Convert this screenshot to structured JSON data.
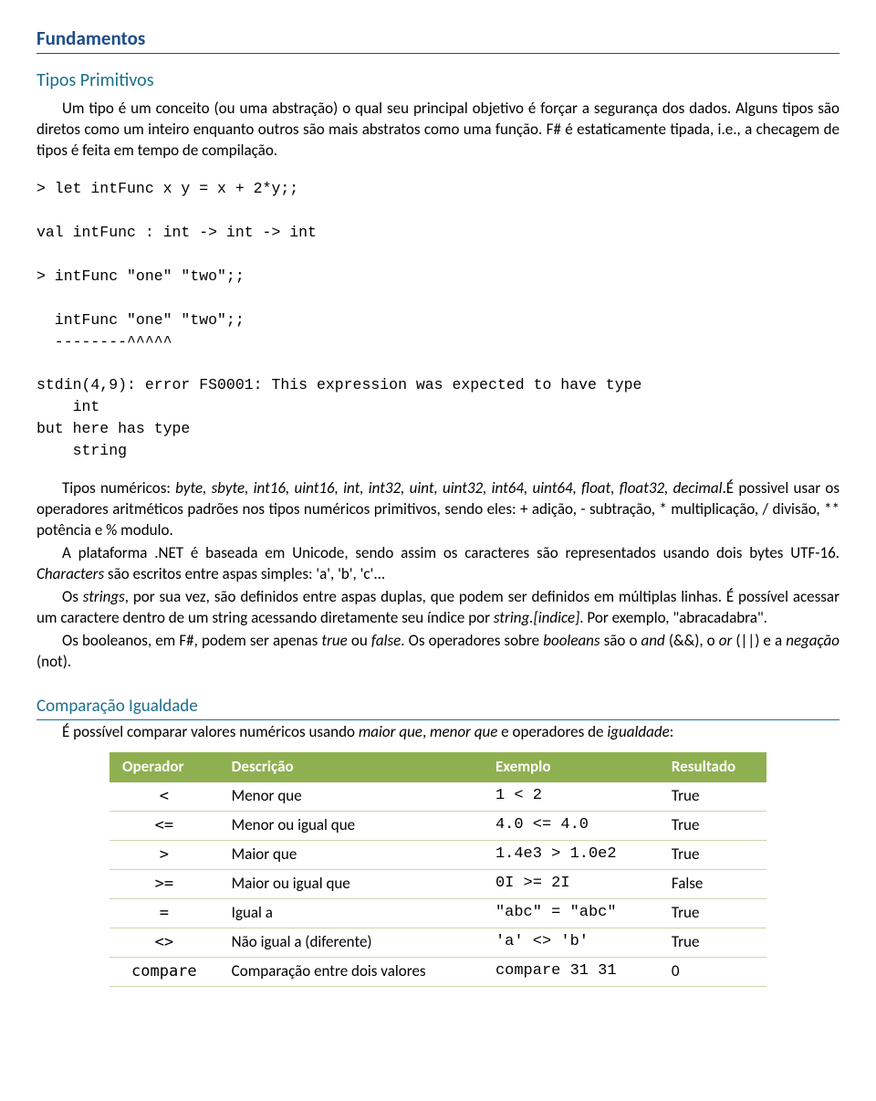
{
  "h1": "Fundamentos",
  "h2": "Tipos Primitivos",
  "p1": "Um tipo é um conceito (ou uma abstração) o qual seu principal objetivo é forçar a segurança dos dados. Alguns tipos são diretos como um inteiro enquanto outros são mais abstratos como uma função. F# é estaticamente tipada, i.e., a checagem de tipos é feita em tempo de compilação.",
  "code": "> let intFunc x y = x + 2*y;;\n\nval intFunc : int -> int -> int\n\n> intFunc \"one\" \"two\";;\n\n  intFunc \"one\" \"two\";;\n  --------^^^^^\n\nstdin(4,9): error FS0001: This expression was expected to have type\n    int\nbut here has type\n    string",
  "p2_a": "Tipos numéricos: ",
  "p2_b": "byte, sbyte, int16, uint16, int, int32, uint, uint32, int64, uint64, float, float32, deci­mal",
  "p2_c": ".É possivel usar os operadores aritméticos padrões nos tipos numéricos primitivos, sendo eles: + adição, - subtração, * multiplicação, / divisão, ** potência e % modulo.",
  "p3_a": "A plataforma .NET é baseada em Unicode, sendo assim os caracteres são representados usando dois bytes UTF-16. ",
  "p3_b": "Characters",
  "p3_c": " são escritos entre aspas simples: 'a', 'b', 'c'...",
  "p4_a": "Os ",
  "p4_b": "strings",
  "p4_c": ", por sua vez, são definidos entre aspas duplas, que podem ser definidos em múltiplas li­nhas. É possível acessar um caractere dentro de um string acessando diretamente seu índice por ",
  "p4_d": "s­tring.[indice]",
  "p4_e": ". Por exemplo, \"abracadabra\".",
  "p5_a": "Os booleanos, em F#, podem ser apenas ",
  "p5_b": "true",
  "p5_c": " ou ",
  "p5_d": "false",
  "p5_e": ". Os operadores sobre ",
  "p5_f": "booleans",
  "p5_g": " são o ",
  "p5_h": "and",
  "p5_i": " (&&), o ",
  "p5_j": "or",
  "p5_k": " (||) e a ",
  "p5_l": "negação",
  "p5_m": " (not).",
  "h3": "Comparação Igualdade",
  "p6_a": "É possível comparar valores numéricos usando ",
  "p6_b": "maior que",
  "p6_c": ", ",
  "p6_d": "menor que",
  "p6_e": " e operadores de ",
  "p6_f": "igualdade",
  "p6_g": ":",
  "th": {
    "op": "Operador",
    "desc": "Descrição",
    "ex": "Exemplo",
    "res": "Resultado"
  },
  "rows": [
    {
      "op": "<",
      "desc": "Menor que",
      "ex": "1 < 2",
      "res": "True"
    },
    {
      "op": "<=",
      "desc": "Menor ou igual que",
      "ex": "4.0 <= 4.0",
      "res": "True"
    },
    {
      "op": ">",
      "desc": "Maior que",
      "ex": "1.4e3 > 1.0e2",
      "res": "True"
    },
    {
      "op": ">=",
      "desc": "Maior ou igual que",
      "ex": "0I >= 2I",
      "res": "False"
    },
    {
      "op": "=",
      "desc": "Igual a",
      "ex": "\"abc\" = \"abc\"",
      "res": "True"
    },
    {
      "op": "<>",
      "desc": "Não igual a (diferente)",
      "ex": "'a' <> 'b'",
      "res": "True"
    },
    {
      "op": "compare",
      "desc": "Comparação entre dois valores",
      "ex": "compare 31 31",
      "res": "0"
    }
  ]
}
